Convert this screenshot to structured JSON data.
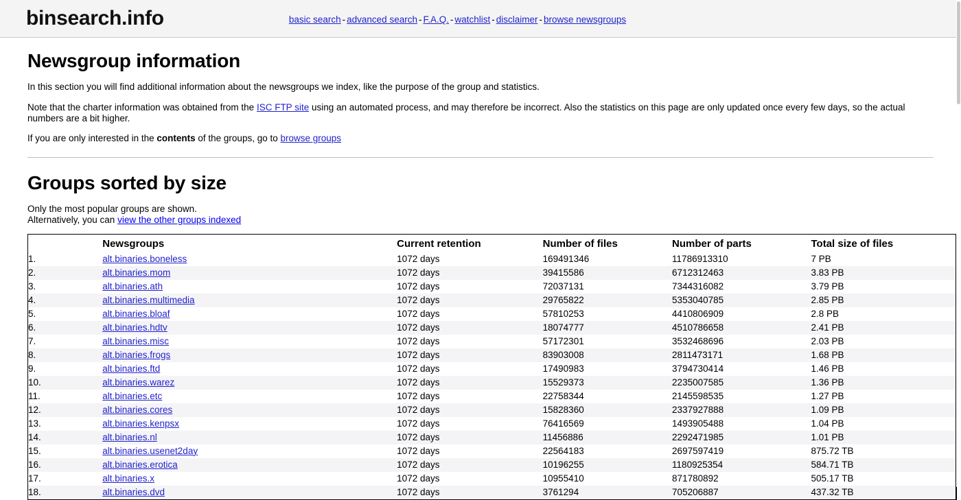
{
  "header": {
    "brand": "binsearch.info",
    "nav": [
      {
        "label": "basic search"
      },
      {
        "label": "advanced search"
      },
      {
        "label": "F.A.Q."
      },
      {
        "label": "watchlist"
      },
      {
        "label": "disclaimer"
      },
      {
        "label": "browse newsgroups"
      }
    ],
    "separator": "-"
  },
  "info_section": {
    "title": "Newsgroup information",
    "p1": "In this section you will find additional information about the newsgroups we index, like the purpose of the group and statistics.",
    "p2_before": "Note that the charter information was obtained from the ",
    "p2_link": "ISC FTP site",
    "p2_after": " using an automated process, and may therefore be incorrect. Also the statistics on this page are only updated once every few days, so the actual numbers are a bit higher.",
    "p3_before": "If you are only interested in the ",
    "p3_bold": "contents",
    "p3_mid": " of the groups, go to ",
    "p3_link": "browse groups"
  },
  "groups_section": {
    "title": "Groups sorted by size",
    "note_line1": "Only the most popular groups are shown.",
    "note_line2_before": "Alternatively, you can ",
    "note_line2_link": "view the other groups indexed"
  },
  "table": {
    "columns": {
      "index": "",
      "name": "Newsgroups",
      "retention": "Current retention",
      "files": "Number of files",
      "parts": "Number of parts",
      "size": "Total size of files"
    },
    "rows": [
      {
        "idx": "1.",
        "name": "alt.binaries.boneless",
        "retention": "1072 days",
        "files": "169491346",
        "parts": "11786913310",
        "size": "7 PB"
      },
      {
        "idx": "2.",
        "name": "alt.binaries.mom",
        "retention": "1072 days",
        "files": "39415586",
        "parts": "6712312463",
        "size": "3.83 PB"
      },
      {
        "idx": "3.",
        "name": "alt.binaries.ath",
        "retention": "1072 days",
        "files": "72037131",
        "parts": "7344316082",
        "size": "3.79 PB"
      },
      {
        "idx": "4.",
        "name": "alt.binaries.multimedia",
        "retention": "1072 days",
        "files": "29765822",
        "parts": "5353040785",
        "size": "2.85 PB"
      },
      {
        "idx": "5.",
        "name": "alt.binaries.bloaf",
        "retention": "1072 days",
        "files": "57810253",
        "parts": "4410806909",
        "size": "2.8 PB"
      },
      {
        "idx": "6.",
        "name": "alt.binaries.hdtv",
        "retention": "1072 days",
        "files": "18074777",
        "parts": "4510786658",
        "size": "2.41 PB"
      },
      {
        "idx": "7.",
        "name": "alt.binaries.misc",
        "retention": "1072 days",
        "files": "57172301",
        "parts": "3532468696",
        "size": "2.03 PB"
      },
      {
        "idx": "8.",
        "name": "alt.binaries.frogs",
        "retention": "1072 days",
        "files": "83903008",
        "parts": "2811473171",
        "size": "1.68 PB"
      },
      {
        "idx": "9.",
        "name": "alt.binaries.ftd",
        "retention": "1072 days",
        "files": "17490983",
        "parts": "3794730414",
        "size": "1.46 PB"
      },
      {
        "idx": "10.",
        "name": "alt.binaries.warez",
        "retention": "1072 days",
        "files": "15529373",
        "parts": "2235007585",
        "size": "1.36 PB"
      },
      {
        "idx": "11.",
        "name": "alt.binaries.etc",
        "retention": "1072 days",
        "files": "22758344",
        "parts": "2145598535",
        "size": "1.27 PB"
      },
      {
        "idx": "12.",
        "name": "alt.binaries.cores",
        "retention": "1072 days",
        "files": "15828360",
        "parts": "2337927888",
        "size": "1.09 PB"
      },
      {
        "idx": "13.",
        "name": "alt.binaries.kenpsx",
        "retention": "1072 days",
        "files": "76416569",
        "parts": "1493905488",
        "size": "1.04 PB"
      },
      {
        "idx": "14.",
        "name": "alt.binaries.nl",
        "retention": "1072 days",
        "files": "11456886",
        "parts": "2292471985",
        "size": "1.01 PB"
      },
      {
        "idx": "15.",
        "name": "alt.binaries.usenet2day",
        "retention": "1072 days",
        "files": "22564183",
        "parts": "2697597419",
        "size": "875.72 TB"
      },
      {
        "idx": "16.",
        "name": "alt.binaries.erotica",
        "retention": "1072 days",
        "files": "10196255",
        "parts": "1180925354",
        "size": "584.71 TB"
      },
      {
        "idx": "17.",
        "name": "alt.binaries.x",
        "retention": "1072 days",
        "files": "10955410",
        "parts": "871780892",
        "size": "505.17 TB"
      },
      {
        "idx": "18.",
        "name": "alt.binaries.dvd",
        "retention": "1072 days",
        "files": "3761294",
        "parts": "705206887",
        "size": "437.32 TB"
      }
    ]
  },
  "colors": {
    "link": "#2222cc",
    "header_bg": "#f4f4f4",
    "row_alt_bg": "#f4f4f7"
  }
}
